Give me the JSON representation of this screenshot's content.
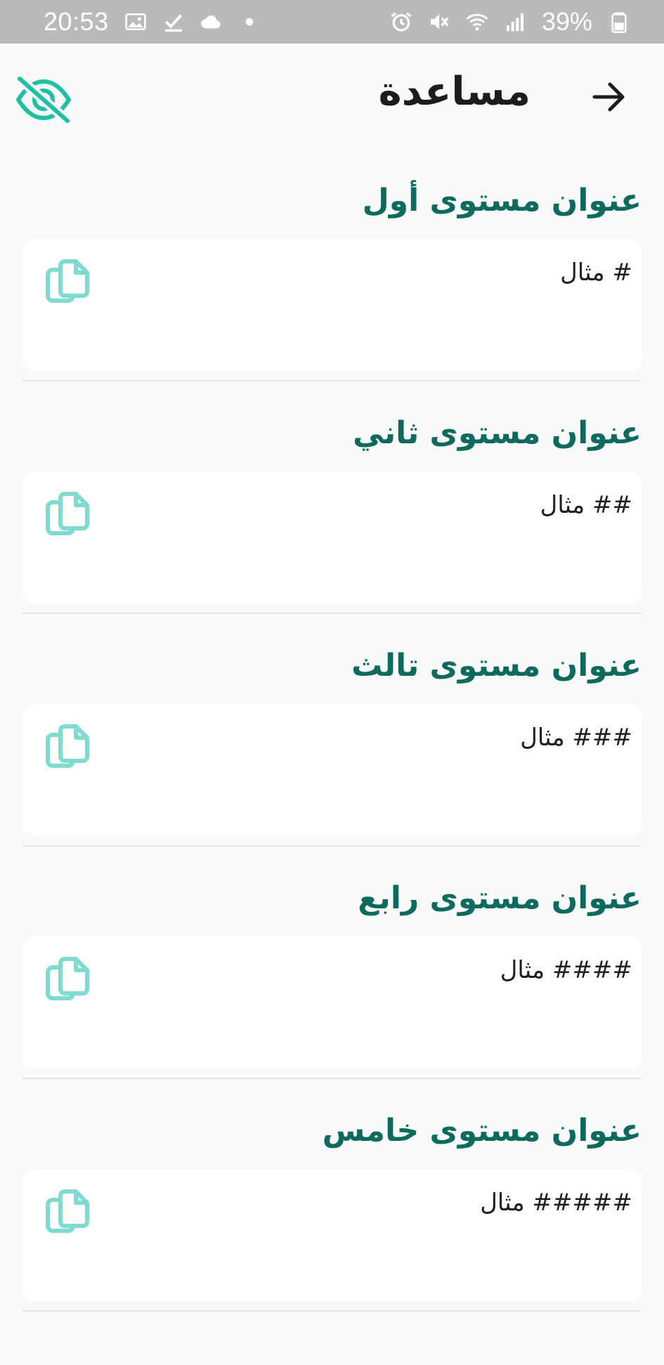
{
  "status_bar": {
    "time": "20:53",
    "battery": "39%",
    "left_icons": [
      "image-icon",
      "check-icon",
      "cloud-icon",
      "dot-icon"
    ],
    "right_icons": [
      "alarm-icon",
      "mute-icon",
      "wifi-icon",
      "signal-icon",
      "battery-icon"
    ]
  },
  "app_bar": {
    "title": "مساعدة",
    "back_icon": "arrow-right-icon",
    "toggle_icon": "eye-off-icon"
  },
  "colors": {
    "accent": "#1fbfa4",
    "heading": "#0f6a5e",
    "copy_icon": "#7fdad0",
    "background": "#f8faf9",
    "status_bar": "#b9bab9"
  },
  "sections": [
    {
      "title": "عنوان مستوى أول",
      "example": "# مثال"
    },
    {
      "title": "عنوان مستوى ثاني",
      "example": "## مثال"
    },
    {
      "title": "عنوان مستوى تالث",
      "example": "### مثال"
    },
    {
      "title": "عنوان مستوى رابع",
      "example": "#### مثال"
    },
    {
      "title": "عنوان مستوى خامس",
      "example": "##### مثال"
    }
  ]
}
